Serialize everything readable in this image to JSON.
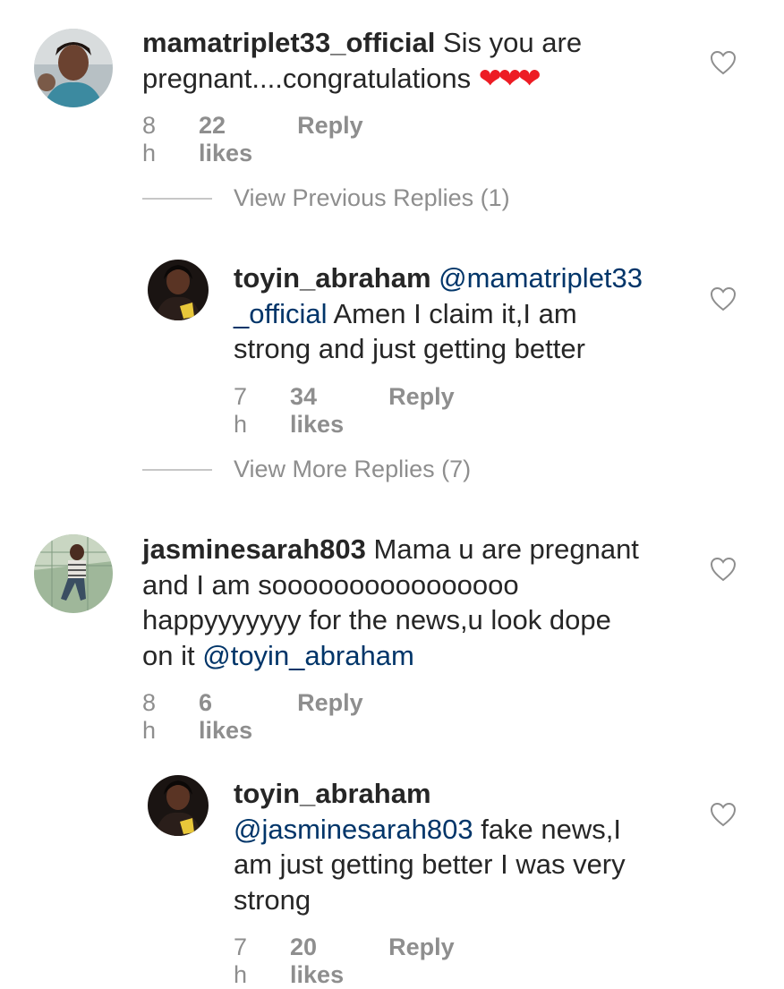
{
  "comments": [
    {
      "username": "mamatriplet33_official",
      "text_line1_after": "Sis you are",
      "text_line2": "pregnant....congratulations",
      "time": "8 h",
      "likes": "22 likes",
      "reply": "Reply"
    },
    {
      "username": "toyin_abraham",
      "mention": "@mamatriplet33",
      "mention_cont": "_official",
      "text_line2_after": "Amen I claim it,I am",
      "text_line3": "strong and just getting better",
      "time": "7 h",
      "likes": "34 likes",
      "reply": "Reply"
    },
    {
      "username": "jasminesarah803",
      "text_line1_after": "Mama u are pregnant",
      "text_line2": "and I am soooooooooooooooo",
      "text_line3": "happyyyyyyy for the news,u look dope",
      "text_line4_before": "on it",
      "mention": "@toyin_abraham",
      "time": "8 h",
      "likes": "6 likes",
      "reply": "Reply"
    },
    {
      "username": "toyin_abraham",
      "mention": "@jasminesarah803",
      "text_line2_after": "fake news,I",
      "text_line3": "am just getting better I was very",
      "text_line4": "strong",
      "time": "7 h",
      "likes": "20 likes",
      "reply": "Reply"
    }
  ],
  "view_previous": "View Previous Replies (1)",
  "view_more": "View More Replies (7)",
  "hearts": "❤❤❤",
  "icons": {
    "like": "heart-outline-icon"
  },
  "colors": {
    "text": "#262626",
    "meta": "#8e8e8e",
    "mention": "#003569",
    "heart": "#ed1c24"
  }
}
